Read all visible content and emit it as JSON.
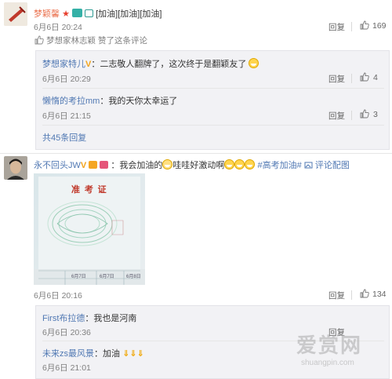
{
  "comments": [
    {
      "author": "梦颖馨",
      "text": "[加油][加油][加油]",
      "time": "6月6日 20:24",
      "liked_by": "梦想家林志颖 赞了这条评论",
      "reply_label": "回复",
      "likes": "169",
      "replies": [
        {
          "author": "梦想家特儿",
          "text": "：二志敬人翻牌了，这次终于是翻颖友了",
          "time": "6月6日 20:29",
          "reply_label": "回复",
          "likes": "4"
        },
        {
          "author": "懒惰的考拉mm",
          "text": "：我的天你太幸运了",
          "time": "6月6日 21:15",
          "reply_label": "回复",
          "likes": "3"
        }
      ],
      "more_replies": "共45条回复"
    },
    {
      "author": "永不回头JW",
      "text_a": "：我会加油的",
      "text_b": "哇哇好激动啊",
      "hashtag": "#高考加油#",
      "comment_image_label": "评论配图",
      "time": "6月6日 20:16",
      "reply_label": "回复",
      "likes": "134",
      "ticket": {
        "title": "准 考 证",
        "row_labels": [
          "6月7日",
          "6月7日",
          "6月8日"
        ]
      },
      "replies": [
        {
          "author": "First布拉德",
          "text": "：我也是河南",
          "time": "6月6日 20:36",
          "reply_label": "回复"
        },
        {
          "author": "未来zs最风景",
          "text": "：加油",
          "time": "6月6日 21:01",
          "reply_label": "回复"
        }
      ]
    }
  ],
  "watermark": {
    "main": "爱赏网",
    "sub": "shuangpin.com"
  }
}
